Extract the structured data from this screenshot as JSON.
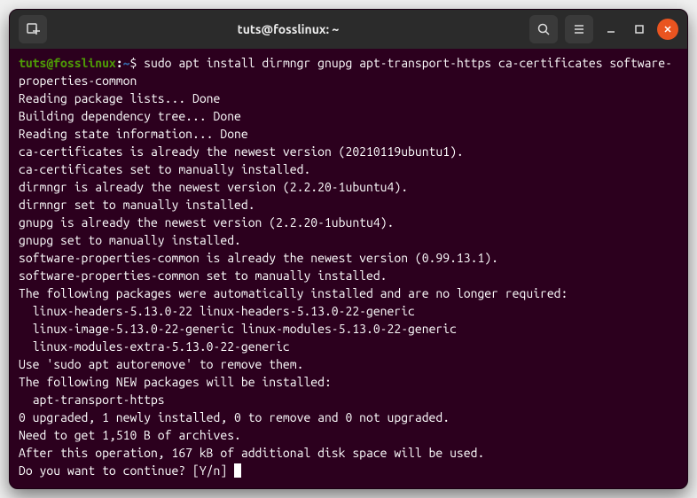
{
  "window": {
    "title": "tuts@fosslinux: ~"
  },
  "prompt": {
    "user_host": "tuts@fosslinux",
    "path": "~",
    "symbol": "$"
  },
  "command": "sudo apt install dirmngr gnupg apt-transport-https ca-certificates software-properties-common",
  "output": [
    "Reading package lists... Done",
    "Building dependency tree... Done",
    "Reading state information... Done",
    "ca-certificates is already the newest version (20210119ubuntu1).",
    "ca-certificates set to manually installed.",
    "dirmngr is already the newest version (2.2.20-1ubuntu4).",
    "dirmngr set to manually installed.",
    "gnupg is already the newest version (2.2.20-1ubuntu4).",
    "gnupg set to manually installed.",
    "software-properties-common is already the newest version (0.99.13.1).",
    "software-properties-common set to manually installed.",
    "The following packages were automatically installed and are no longer required:",
    "  linux-headers-5.13.0-22 linux-headers-5.13.0-22-generic",
    "  linux-image-5.13.0-22-generic linux-modules-5.13.0-22-generic",
    "  linux-modules-extra-5.13.0-22-generic",
    "Use 'sudo apt autoremove' to remove them.",
    "The following NEW packages will be installed:",
    "  apt-transport-https",
    "0 upgraded, 1 newly installed, 0 to remove and 0 not upgraded.",
    "Need to get 1,510 B of archives.",
    "After this operation, 167 kB of additional disk space will be used.",
    "Do you want to continue? [Y/n] "
  ]
}
